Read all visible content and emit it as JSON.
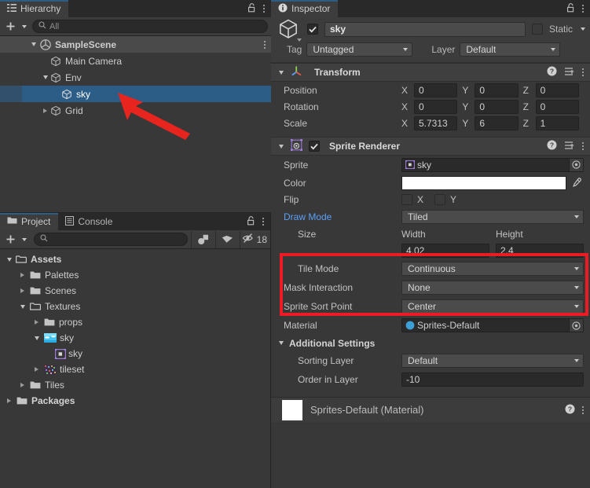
{
  "hierarchy": {
    "tab_label": "Hierarchy",
    "tab_icon": "hierarchy-icon",
    "lock_icon": "lock-icon",
    "menu_icon": "kebab-menu-icon",
    "toolbar": {
      "add_label": "+",
      "search_value": "",
      "search_placeholder": "All"
    },
    "items": [
      {
        "label": "SampleScene",
        "depth": 0,
        "icon": "unity-scene-icon",
        "expander": "down",
        "style": "scene"
      },
      {
        "label": "Main Camera",
        "depth": 1,
        "icon": "gameobject-cube-icon",
        "expander": "none",
        "style": "normal"
      },
      {
        "label": "Env",
        "depth": 1,
        "icon": "gameobject-cube-icon",
        "expander": "down",
        "style": "normal"
      },
      {
        "label": "sky",
        "depth": 2,
        "icon": "gameobject-cube-icon",
        "expander": "none",
        "style": "selected"
      },
      {
        "label": "Grid",
        "depth": 1,
        "icon": "gameobject-cube-icon",
        "expander": "right",
        "style": "normal"
      }
    ]
  },
  "project": {
    "tabs": [
      {
        "label": "Project",
        "icon": "folder-icon",
        "active": true
      },
      {
        "label": "Console",
        "icon": "console-icon",
        "active": false
      }
    ],
    "lock_icon": "lock-icon",
    "menu_icon": "kebab-menu-icon",
    "toolbar": {
      "add_label": "+",
      "search_value": "",
      "search_placeholder": "",
      "type_filter_icon": "search-by-type-icon",
      "label_filter_icon": "search-by-label-icon",
      "hidden_icon": "eye-off-icon",
      "hidden_count": "18"
    },
    "tree": [
      {
        "label": "Assets",
        "depth": 0,
        "expander": "down",
        "icon": "folder-open-icon",
        "bold": true
      },
      {
        "label": "Palettes",
        "depth": 1,
        "expander": "right",
        "icon": "folder-icon",
        "bold": false
      },
      {
        "label": "Scenes",
        "depth": 1,
        "expander": "right",
        "icon": "folder-icon",
        "bold": false
      },
      {
        "label": "Textures",
        "depth": 1,
        "expander": "down",
        "icon": "folder-open-icon",
        "bold": false
      },
      {
        "label": "props",
        "depth": 2,
        "expander": "right",
        "icon": "folder-icon",
        "bold": false
      },
      {
        "label": "sky",
        "depth": 2,
        "expander": "down",
        "icon": "texture-sky-icon",
        "bold": false
      },
      {
        "label": "sky",
        "depth": 3,
        "expander": "none",
        "icon": "sprite-icon",
        "bold": false
      },
      {
        "label": "tileset",
        "depth": 2,
        "expander": "right",
        "icon": "texture-tileset-icon",
        "bold": false
      },
      {
        "label": "Tiles",
        "depth": 1,
        "expander": "right",
        "icon": "folder-icon",
        "bold": false
      },
      {
        "label": "Packages",
        "depth": 0,
        "expander": "right",
        "icon": "folder-icon",
        "bold": true
      }
    ]
  },
  "inspector": {
    "tab_label": "Inspector",
    "tab_icon": "info-icon",
    "lock_icon": "lock-icon",
    "menu_icon": "kebab-menu-icon",
    "gameobject": {
      "icon": "gameobject-cube-icon",
      "enabled": true,
      "name_value": "sky",
      "static_checked": false,
      "static_label": "Static",
      "tag_label": "Tag",
      "tag_value": "Untagged",
      "layer_label": "Layer",
      "layer_value": "Default"
    },
    "transform": {
      "title": "Transform",
      "icon": "transform-axes-icon",
      "help_icon": "help-icon",
      "preset_icon": "preset-icon",
      "menu_icon": "kebab-menu-icon",
      "rows": [
        {
          "label": "Position",
          "x": "0",
          "y": "0",
          "z": "0"
        },
        {
          "label": "Rotation",
          "x": "0",
          "y": "0",
          "z": "0"
        },
        {
          "label": "Scale",
          "x": "5.7313",
          "y": "6",
          "z": "1"
        }
      ],
      "axis_labels": [
        "X",
        "Y",
        "Z"
      ]
    },
    "sprite_renderer": {
      "title": "Sprite Renderer",
      "icon": "sprite-renderer-icon",
      "enabled": true,
      "help_icon": "help-icon",
      "preset_icon": "preset-icon",
      "menu_icon": "kebab-menu-icon",
      "sprite_label": "Sprite",
      "sprite_value": "sky",
      "sprite_icon": "sprite-icon",
      "color_label": "Color",
      "color_value": "#FFFFFF",
      "eyedropper_icon": "eyedropper-icon",
      "flip_label": "Flip",
      "flip_x_label": "X",
      "flip_y_label": "Y",
      "flip_x": false,
      "flip_y": false,
      "draw_mode_label": "Draw Mode",
      "draw_mode_value": "Tiled",
      "size_label": "Size",
      "size_width_label": "Width",
      "size_height_label": "Height",
      "size_width": "4.02",
      "size_height": "2.4",
      "tile_mode_label": "Tile Mode",
      "tile_mode_value": "Continuous",
      "mask_interaction_label": "Mask Interaction",
      "mask_interaction_value": "None",
      "sort_point_label": "Sprite Sort Point",
      "sort_point_value": "Center",
      "material_label": "Material",
      "material_value": "Sprites-Default",
      "material_icon": "material-sphere-icon",
      "additional_settings_label": "Additional Settings",
      "sorting_layer_label": "Sorting Layer",
      "sorting_layer_value": "Default",
      "order_in_layer_label": "Order in Layer",
      "order_in_layer_value": "-10"
    },
    "material_preview": {
      "title": "Sprites-Default (Material)",
      "help_icon": "help-icon",
      "menu_icon": "kebab-menu-icon"
    }
  },
  "annotations": {
    "highlight_color": "#ed1c24",
    "arrow_color": "#e8241f",
    "box_target": "draw-mode-and-size-rows",
    "arrow_target": "hierarchy-sky-item"
  }
}
